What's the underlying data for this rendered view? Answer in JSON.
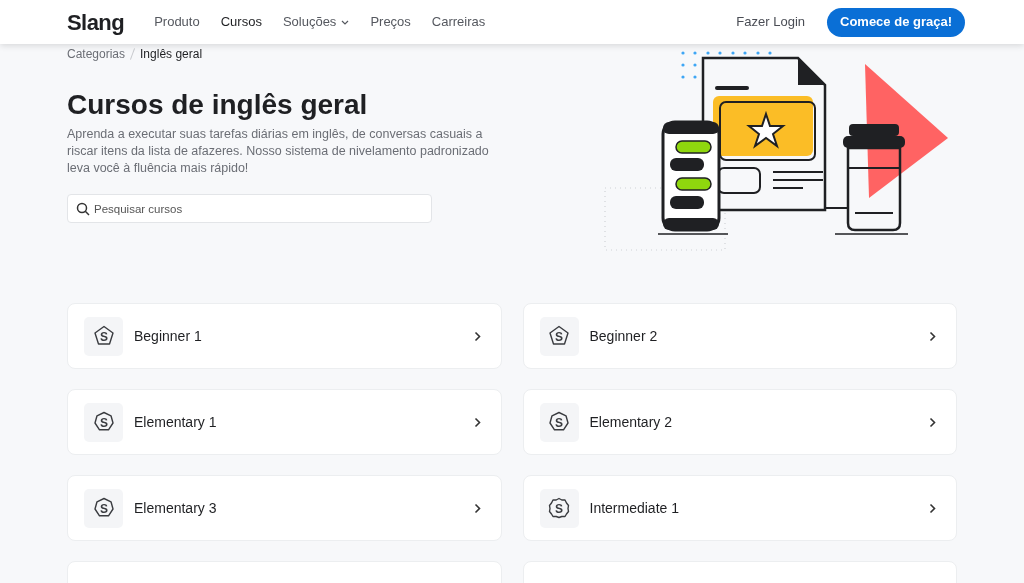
{
  "header": {
    "logo": "Slang",
    "nav": [
      {
        "label": "Produto",
        "selected": false,
        "dropdown": false
      },
      {
        "label": "Cursos",
        "selected": true,
        "dropdown": false
      },
      {
        "label": "Soluções",
        "selected": false,
        "dropdown": true
      },
      {
        "label": "Preços",
        "selected": false,
        "dropdown": false
      },
      {
        "label": "Carreiras",
        "selected": false,
        "dropdown": false
      }
    ],
    "login": "Fazer Login",
    "cta": "Comece de graça!"
  },
  "breadcrumb": [
    "Categorias",
    "Inglês geral"
  ],
  "title": "Cursos de inglês geral",
  "description": "Aprenda a executar suas tarefas diárias em inglês, de conversas casuais a riscar itens da lista de afazeres. Nosso sistema de nivelamento padronizado leva você à fluência mais rápido!",
  "search": {
    "placeholder": "Pesquisar cursos"
  },
  "courses": [
    {
      "name": "Beginner 1",
      "badge": "S",
      "kind": "pentagon"
    },
    {
      "name": "Beginner 2",
      "badge": "S",
      "kind": "pentagon"
    },
    {
      "name": "Elementary 1",
      "badge": "S",
      "kind": "heptagon"
    },
    {
      "name": "Elementary 2",
      "badge": "S",
      "kind": "heptagon"
    },
    {
      "name": "Elementary 3",
      "badge": "S",
      "kind": "heptagon"
    },
    {
      "name": "Intermediate 1",
      "badge": "S",
      "kind": "circle"
    }
  ]
}
